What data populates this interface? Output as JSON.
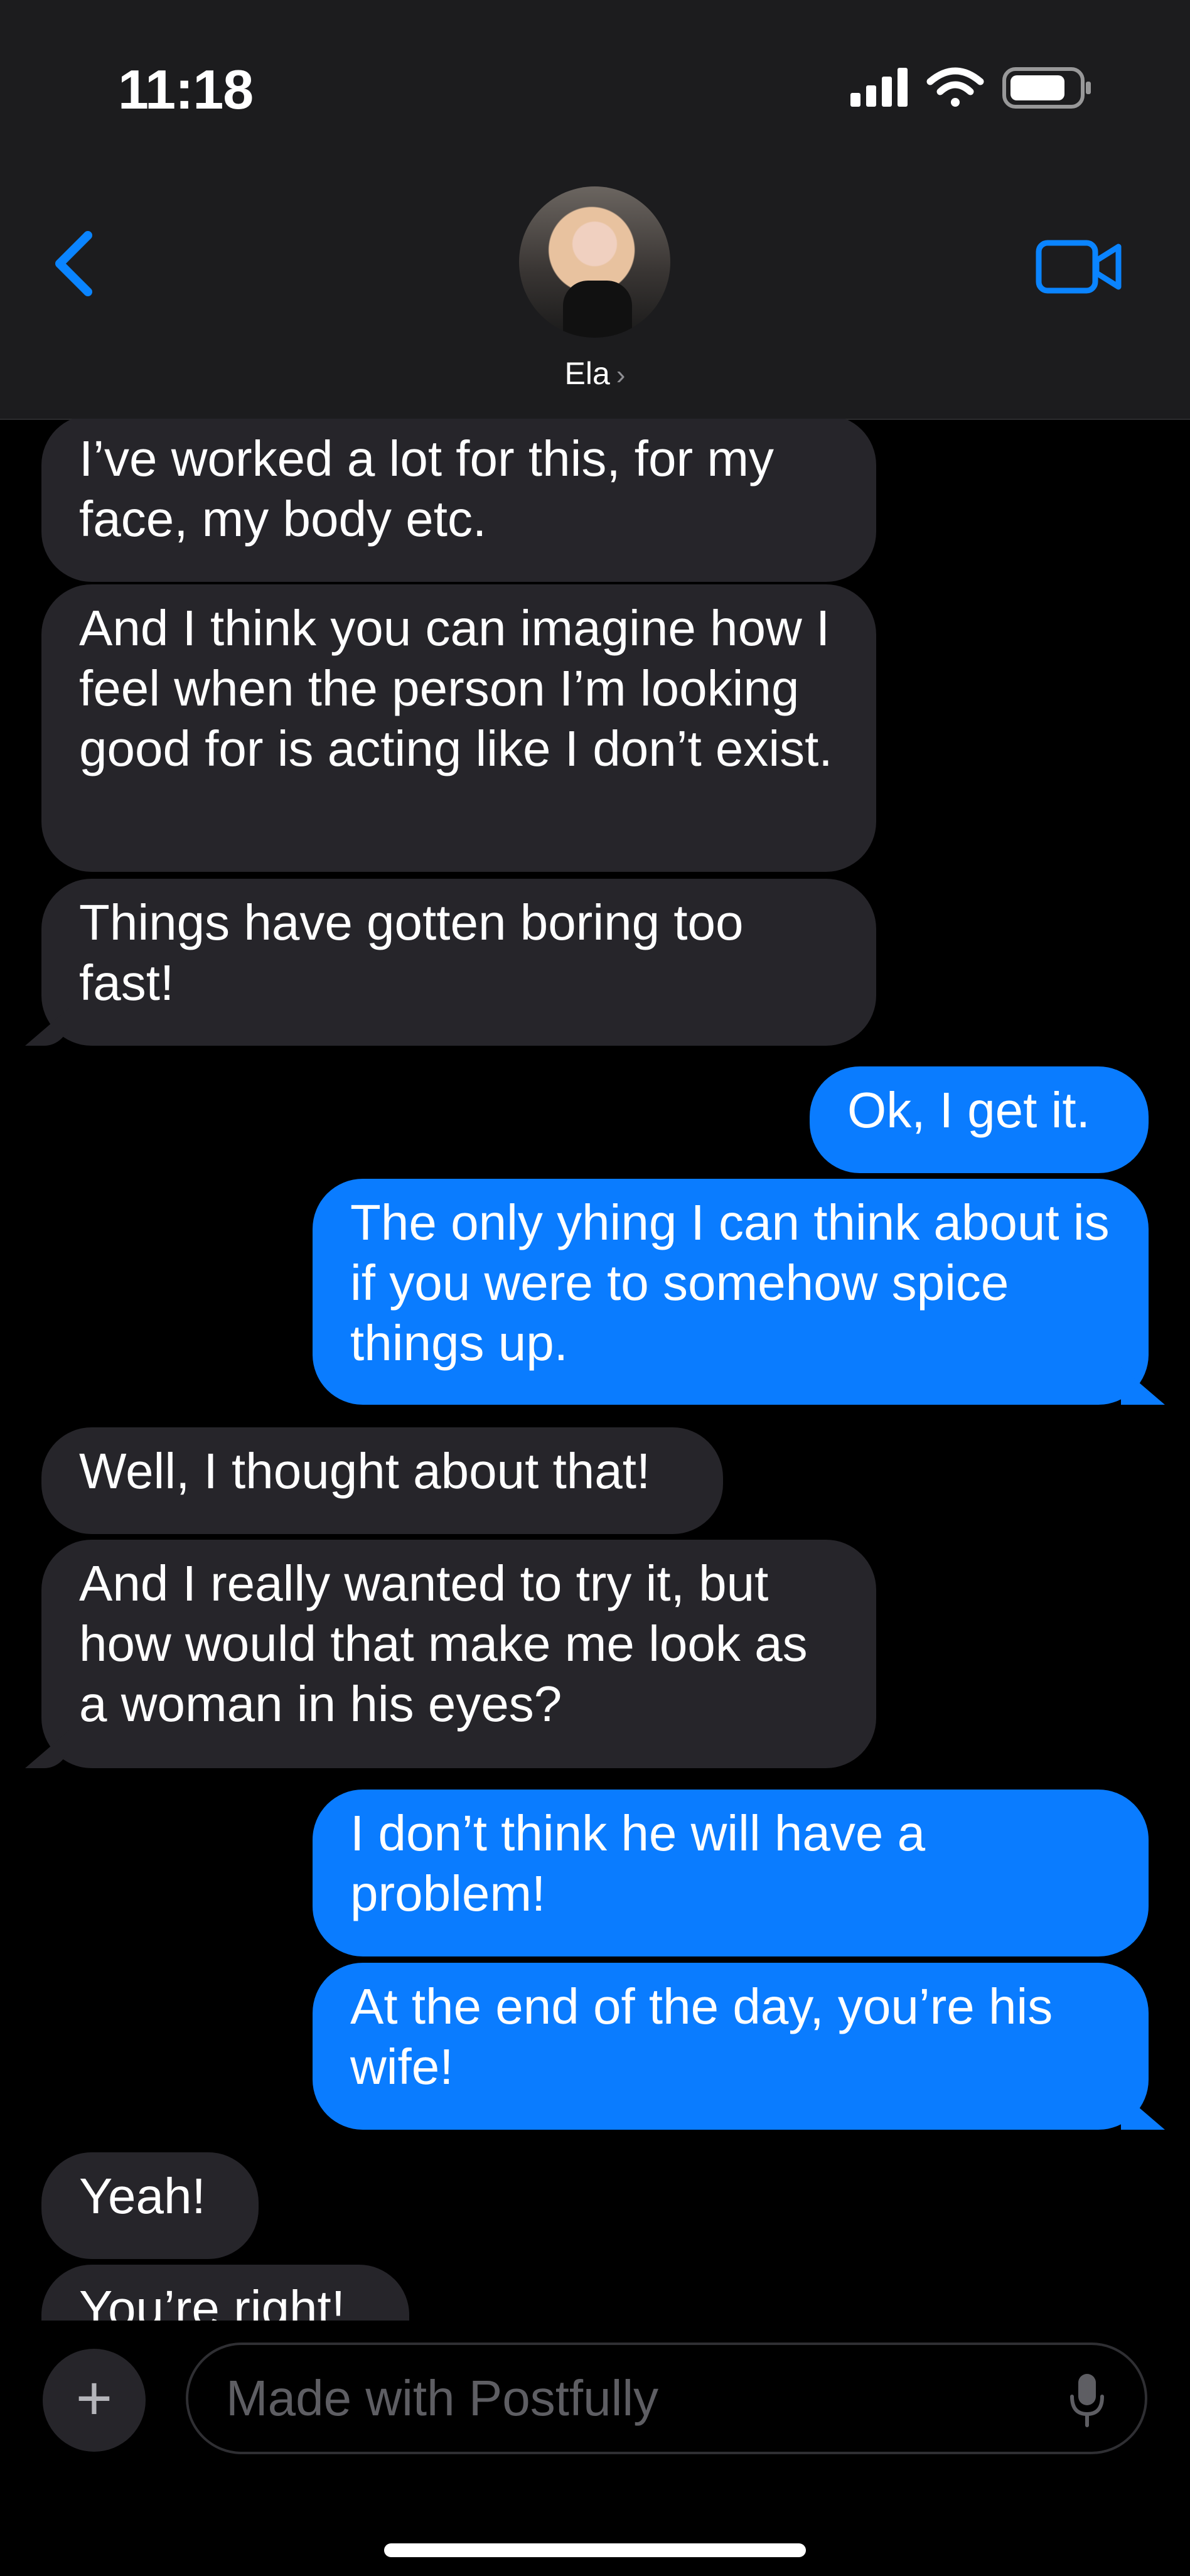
{
  "status_bar": {
    "time": "11:18"
  },
  "header": {
    "contact_name": "Ela",
    "chevron": "›"
  },
  "messages": [
    {
      "from": "them",
      "text": "I’ve worked a lot for this, for my face, my body etc."
    },
    {
      "from": "them",
      "text": "And I think you can imagine how I feel when the person I’m looking good for is acting like I don’t exist."
    },
    {
      "from": "them",
      "text": "Things have gotten boring too fast!"
    },
    {
      "from": "me",
      "text": "Ok, I get it."
    },
    {
      "from": "me",
      "text": "The only yhing I can think about is if you were to somehow spice things up."
    },
    {
      "from": "them",
      "text": "Well, I thought about that!"
    },
    {
      "from": "them",
      "text": "And I really wanted to try it, but how would that make me look as a woman in his eyes?"
    },
    {
      "from": "me",
      "text": "I don’t think he will have a problem!"
    },
    {
      "from": "me",
      "text": "At the end of the day, you’re his wife!"
    },
    {
      "from": "them",
      "text": "Yeah!"
    },
    {
      "from": "them",
      "text": "You’re right!"
    }
  ],
  "composer": {
    "placeholder": "Made with Postfully",
    "plus": "+"
  },
  "colors": {
    "outgoing": "#0a7cff",
    "incoming": "#26252a",
    "accent": "#0a84ff"
  },
  "icons": [
    "signal-icon",
    "wifi-icon",
    "battery-icon",
    "back-chevron-icon",
    "video-call-icon",
    "plus-icon",
    "microphone-icon"
  ]
}
